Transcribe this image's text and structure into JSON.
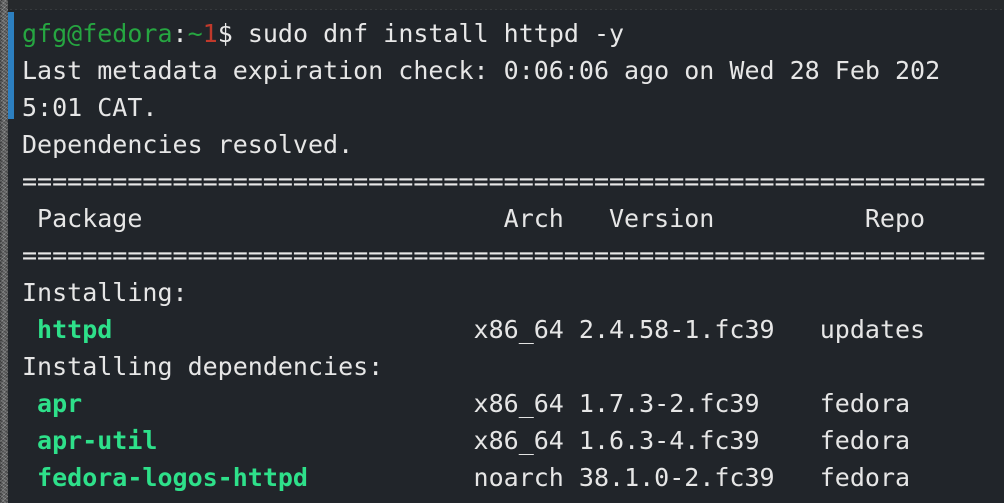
{
  "window": {
    "app": "terminal",
    "background_color": "#21252a",
    "foreground_color": "#e6e6e6",
    "accent_color": "#2c7fc0"
  },
  "prompt": {
    "user_host": "gfg@fedora",
    "colon": ":",
    "tilde": "~",
    "jobs": "1",
    "dollar": "$ ",
    "command": "sudo dnf install httpd -y",
    "user_host_color": "#26a641",
    "tilde_color": "#26a641",
    "jobs_color": "#c0392b"
  },
  "output": {
    "metadata_line": "Last metadata expiration check: 0:06:06 ago on Wed 28 Feb 202",
    "metadata_line_wrap": "5:01 CAT.",
    "deps_resolved": "Dependencies resolved.",
    "separator": "================================================================",
    "headers": {
      "package": " Package",
      "arch": "Arch",
      "version": "Version",
      "repo": "Repo",
      "header_row": " Package                        Arch   Version          Repo"
    },
    "installing_label": "Installing:",
    "installing_deps_label": "Installing dependencies:"
  },
  "packages": [
    {
      "name": " httpd",
      "name_padded": " httpd                        ",
      "arch": "x86_64",
      "version": "2.4.58-1.fc39",
      "version_padded": "2.4.58-1.fc39   ",
      "repo": "updates"
    },
    {
      "name": " apr",
      "name_padded": " apr                          ",
      "arch": "x86_64",
      "version": "1.7.3-2.fc39",
      "version_padded": "1.7.3-2.fc39    ",
      "repo": "fedora"
    },
    {
      "name": " apr-util",
      "name_padded": " apr-util                     ",
      "arch": "x86_64",
      "version": "1.6.3-4.fc39",
      "version_padded": "1.6.3-4.fc39    ",
      "repo": "fedora"
    },
    {
      "name": " fedora-logos-httpd",
      "name_padded": " fedora-logos-httpd           ",
      "arch": "noarch",
      "version": "38.1.0-2.fc39",
      "version_padded": "38.1.0-2.fc39   ",
      "repo": "fedora"
    }
  ]
}
